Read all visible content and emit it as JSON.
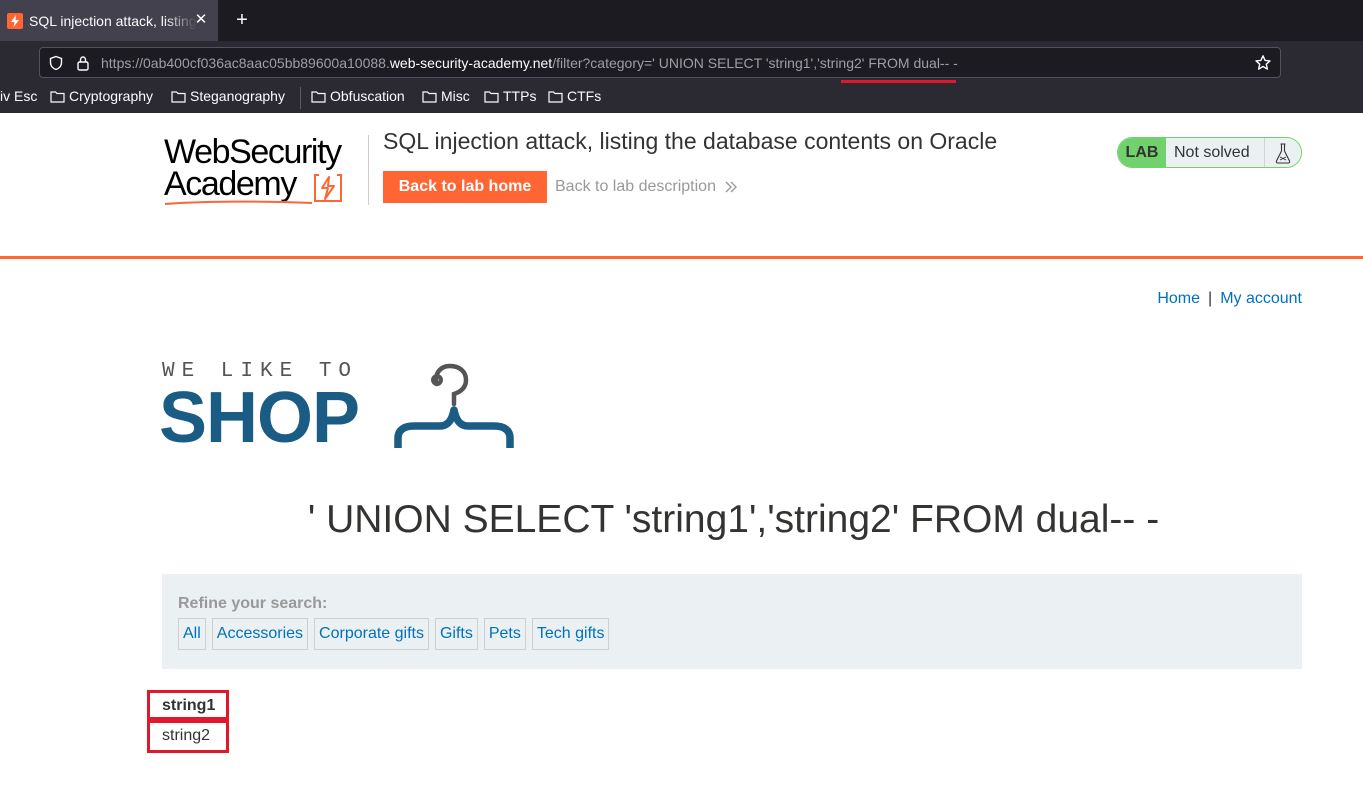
{
  "browser": {
    "tab_title": "SQL injection attack, listing the database contents on Oracle",
    "url_prefix": "https://0ab400cf036ac8aac05bb89600a10088.",
    "url_host": "web-security-academy.net",
    "url_path": "/filter?category=' UNION SELECT 'string1','string2' FROM dual-- -",
    "bookmarks": [
      "iv Esc",
      "Cryptography",
      "Steganography",
      "Obfuscation",
      "Misc",
      "TTPs",
      "CTFs"
    ]
  },
  "lab_header": {
    "logo_line1": "WebSecurity",
    "logo_line2": "Academy",
    "title": "SQL injection attack, listing the database contents on Oracle",
    "back_home_label": "Back to lab home",
    "back_description_label": "Back to lab description",
    "badge_label": "LAB",
    "status_label": "Not solved"
  },
  "shop": {
    "nav": {
      "home": "Home",
      "separator": "|",
      "account": "My account"
    },
    "logo_tagline": "WE LIKE TO",
    "logo_word": "SHOP",
    "heading": "' UNION SELECT 'string1','string2' FROM dual-- -",
    "filter": {
      "label": "Refine your search:",
      "categories": [
        "All",
        "Accessories",
        "Corporate gifts",
        "Gifts",
        "Pets",
        "Tech gifts"
      ]
    },
    "results": {
      "row1": "string1",
      "row2": "string2"
    }
  },
  "colors": {
    "brand_orange": "#ff6633",
    "link_blue": "#0071bc",
    "shop_blue": "#1a5c84",
    "lab_green": "#70d16d",
    "highlight_red": "#e2172b"
  }
}
